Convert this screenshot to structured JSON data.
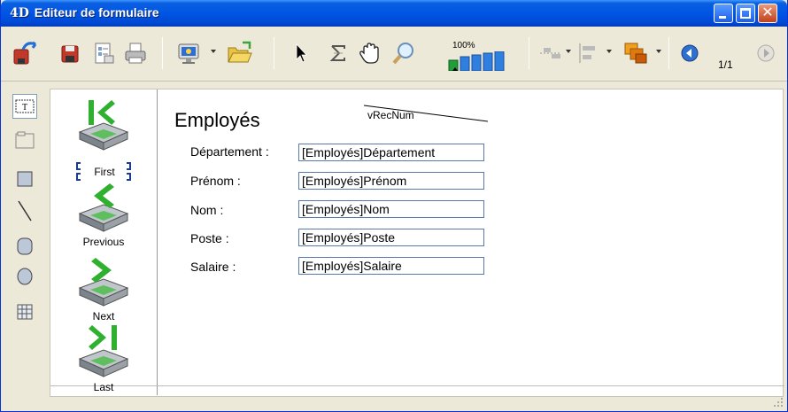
{
  "window": {
    "logo": "4D",
    "title": "Editeur de formulaire"
  },
  "toolbar": {
    "zoom_label": "100%",
    "page_indicator": "1/1"
  },
  "nav_buttons": {
    "first": "First",
    "previous": "Previous",
    "next": "Next",
    "last": "Last"
  },
  "form": {
    "title": "Employés",
    "record_var": "vRecNum",
    "fields": [
      {
        "label": "Département :",
        "value": "[Employés]Département"
      },
      {
        "label": "Prénom :",
        "value": "[Employés]Prénom"
      },
      {
        "label": "Nom :",
        "value": "[Employés]Nom"
      },
      {
        "label": "Poste :",
        "value": "[Employés]Poste"
      },
      {
        "label": "Salaire :",
        "value": "[Employés]Salaire"
      }
    ]
  },
  "colors": {
    "titlebar": "#0055e5",
    "nav_arrow_green": "#2fb02f",
    "field_border": "#5a7aa6"
  },
  "icons": {
    "toolbar": [
      "undo-icon",
      "save-icon",
      "properties-icon",
      "print-icon",
      "preview-icon",
      "open-folder-icon",
      "pointer-icon",
      "sigma-icon",
      "hand-icon",
      "zoom-icon",
      "zoom-level-icon",
      "align-icon",
      "distribute-icon",
      "layers-icon",
      "previous-page-icon",
      "next-page-icon"
    ],
    "tools": [
      "text-tool-icon",
      "groupbox-tool-icon",
      "rectangle-tool-icon",
      "line-tool-icon",
      "rounded-rect-tool-icon",
      "oval-tool-icon",
      "grid-tool-icon"
    ]
  }
}
